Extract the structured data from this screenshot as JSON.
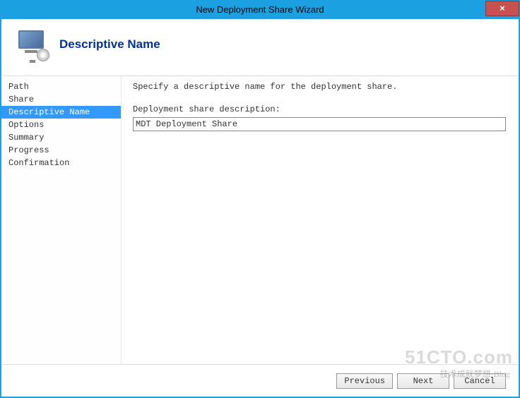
{
  "window": {
    "title": "New Deployment Share Wizard",
    "close": "×"
  },
  "header": {
    "title": "Descriptive Name"
  },
  "sidebar": {
    "steps": [
      {
        "label": "Path",
        "active": false
      },
      {
        "label": "Share",
        "active": false
      },
      {
        "label": "Descriptive Name",
        "active": true
      },
      {
        "label": "Options",
        "active": false
      },
      {
        "label": "Summary",
        "active": false
      },
      {
        "label": "Progress",
        "active": false
      },
      {
        "label": "Confirmation",
        "active": false
      }
    ]
  },
  "content": {
    "instruction": "Specify a descriptive name for the deployment share.",
    "field_label": "Deployment share description:",
    "field_value": "MDT Deployment Share"
  },
  "footer": {
    "previous": "Previous",
    "next": "Next",
    "cancel": "Cancel"
  },
  "watermark": {
    "main": "51CTO.com",
    "sub": "技术成就梦想·Blog"
  }
}
